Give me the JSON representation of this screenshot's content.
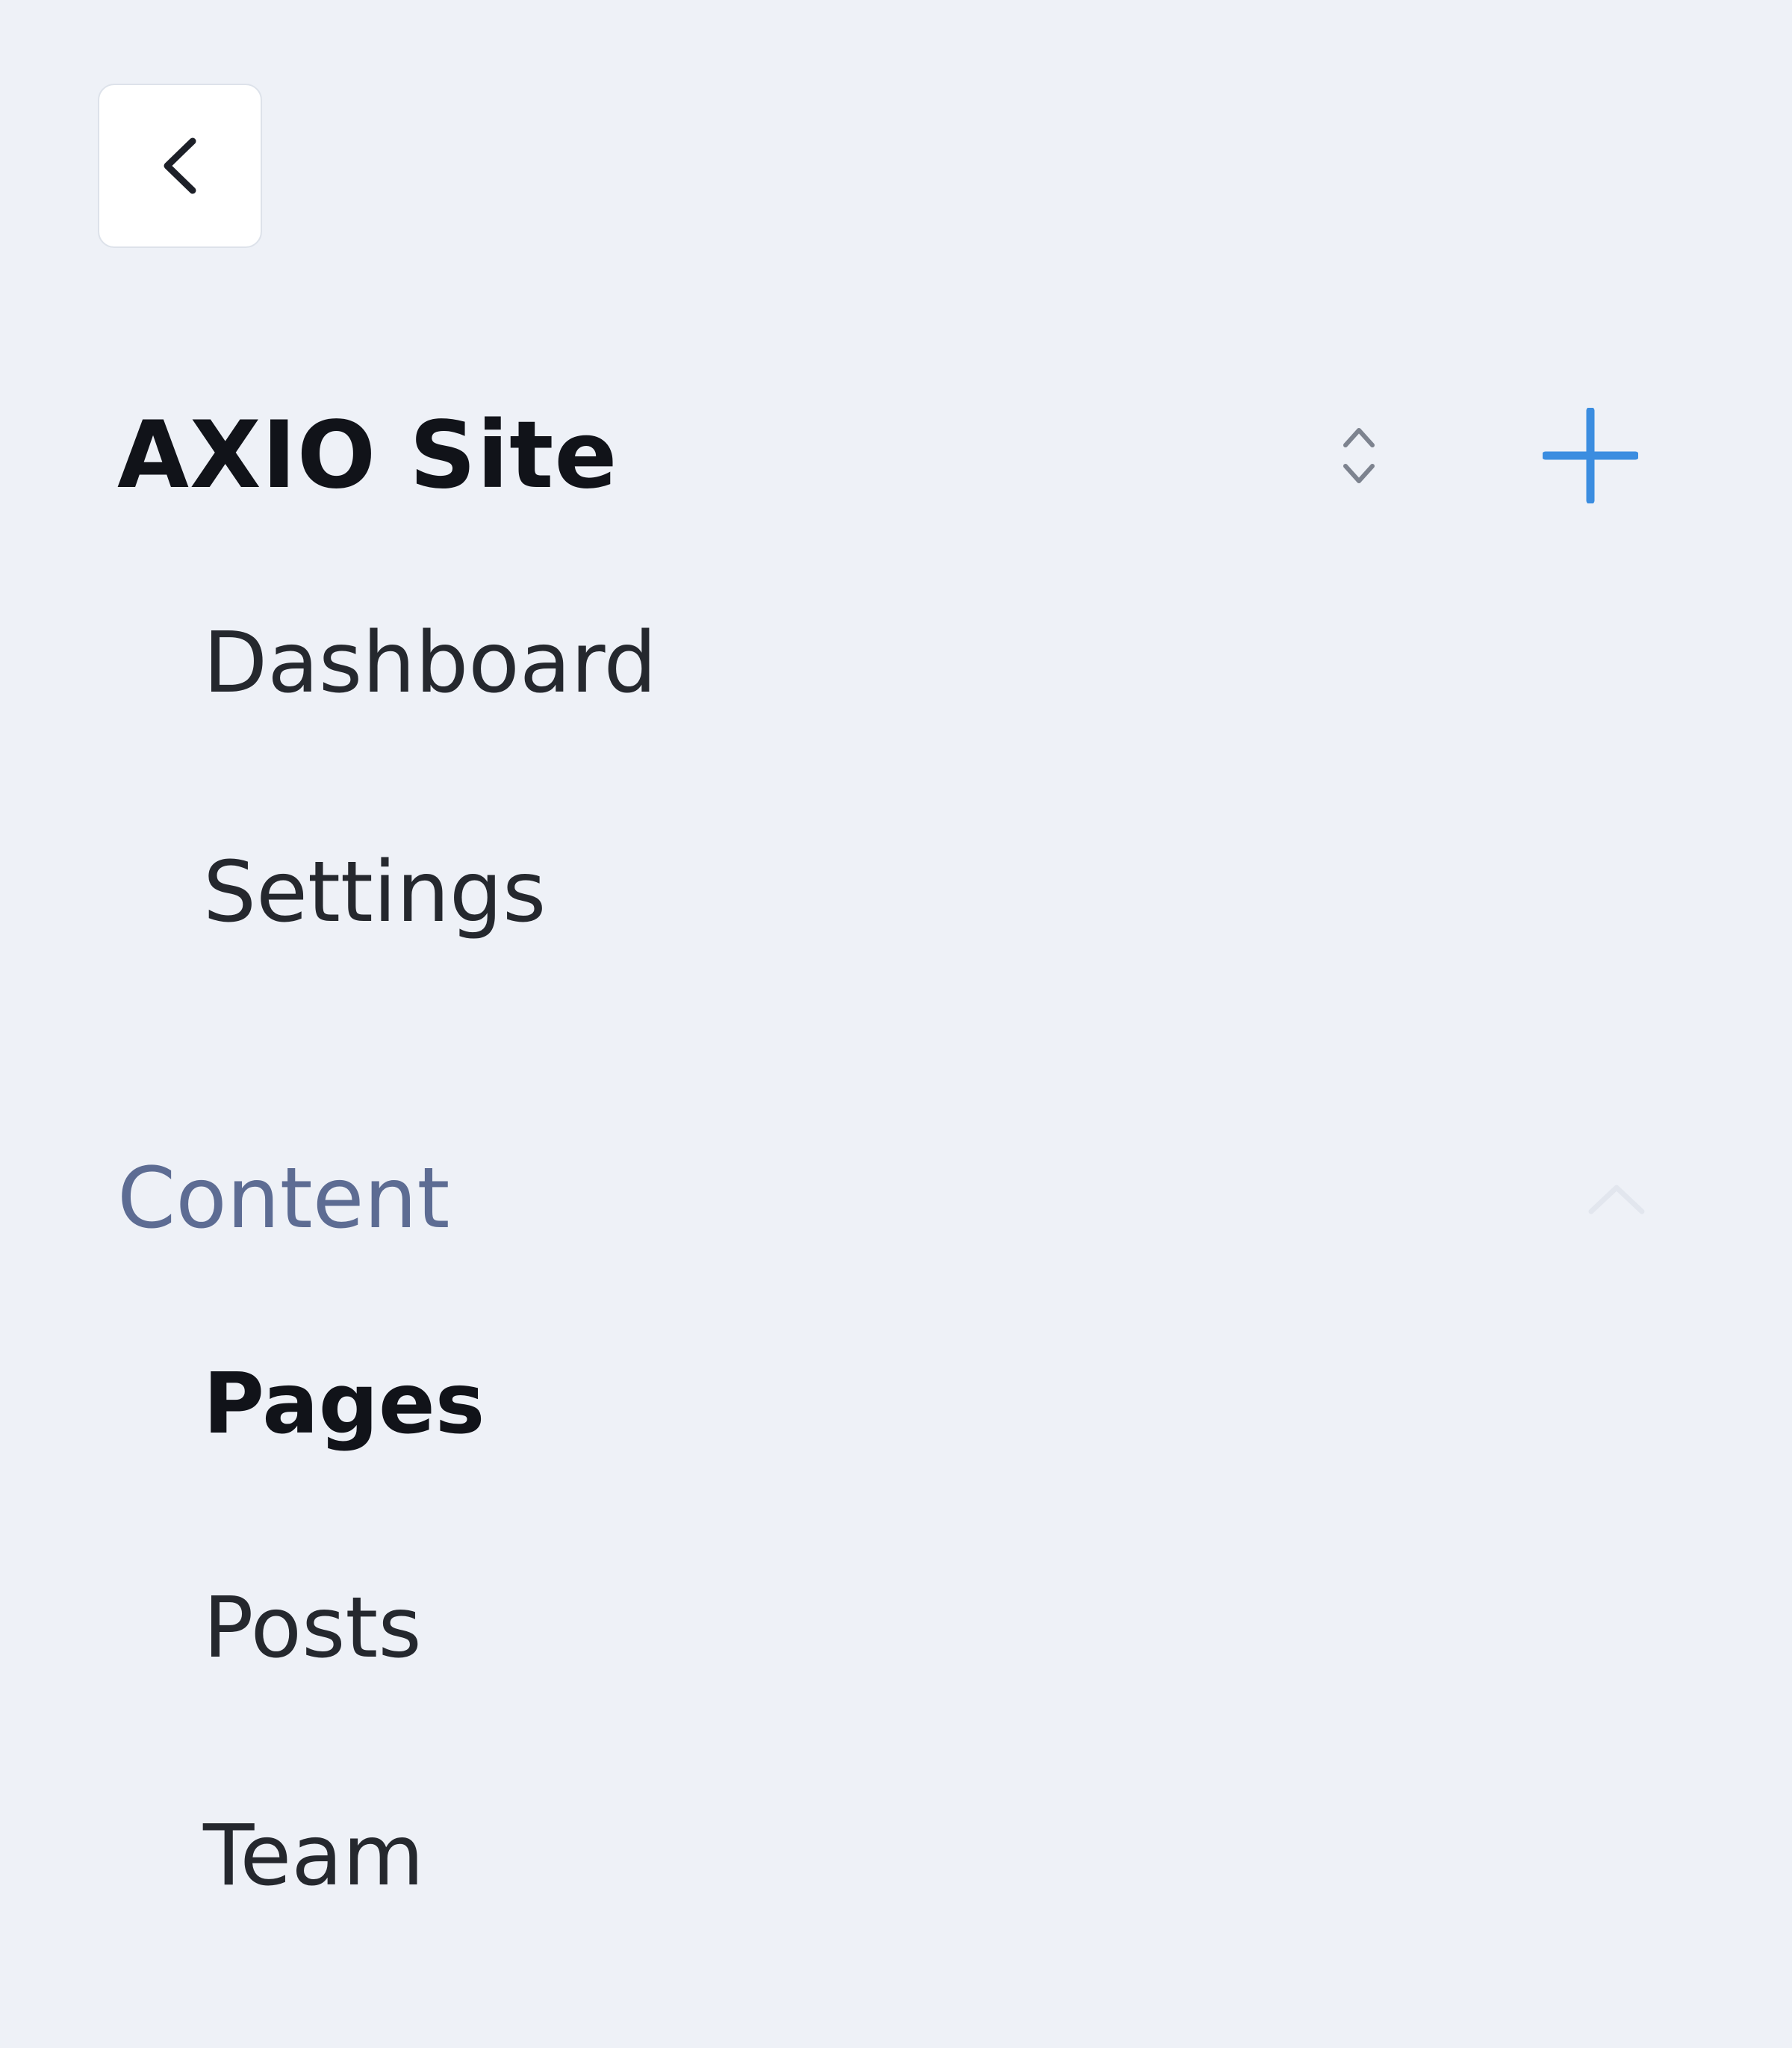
{
  "site": {
    "title": "AXIO Site"
  },
  "colors": {
    "background": "#eef1f7",
    "accent": "#3b8de0",
    "section_label": "#5d6c93",
    "text": "#25282e"
  },
  "icons": {
    "back": "chevron-left-icon",
    "switcher": "chevron-up-down-icon",
    "add": "plus-icon",
    "collapse": "chevron-up-icon"
  },
  "nav": {
    "items": [
      {
        "label": "Dashboard"
      },
      {
        "label": "Settings"
      }
    ]
  },
  "sections": [
    {
      "label": "Content",
      "expanded": true,
      "items": [
        {
          "label": "Pages",
          "active": true
        },
        {
          "label": "Posts",
          "active": false
        },
        {
          "label": "Team",
          "active": false
        }
      ]
    }
  ]
}
